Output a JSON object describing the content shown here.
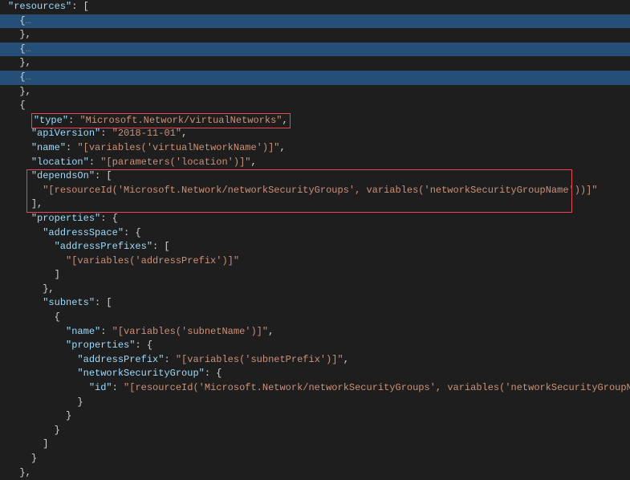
{
  "header": {
    "resources_key": "\"resources\"",
    "colon_bracket": ": ["
  },
  "collapsed": {
    "open": "{",
    "dots": "…",
    "close": "},"
  },
  "obj_open": "{",
  "type_line": {
    "key": "\"type\"",
    "sep": ": ",
    "val": "\"Microsoft.Network/virtualNetworks\"",
    "comma": ","
  },
  "apiVersion": {
    "key": "\"apiVersion\"",
    "sep": ": ",
    "val": "\"2018-11-01\"",
    "comma": ","
  },
  "name": {
    "key": "\"name\"",
    "sep": ": ",
    "val": "\"[variables('virtualNetworkName')]\"",
    "comma": ","
  },
  "location": {
    "key": "\"location\"",
    "sep": ": ",
    "val": "\"[parameters('location')]\"",
    "comma": ","
  },
  "dependsOn": {
    "key": "\"dependsOn\"",
    "sep": ": [",
    "item": "\"[resourceId('Microsoft.Network/networkSecurityGroups', variables('networkSecurityGroupName'))]\"",
    "close": "],"
  },
  "properties": {
    "key": "\"properties\"",
    "sep": ": {"
  },
  "addressSpace": {
    "key": "\"addressSpace\"",
    "sep": ": {",
    "prefixes_key": "\"addressPrefixes\"",
    "prefixes_sep": ": [",
    "prefix_item": "\"[variables('addressPrefix')]\"",
    "close_arr": "]",
    "close_obj": "},"
  },
  "subnets": {
    "key": "\"subnets\"",
    "sep": ": [",
    "open": "{",
    "name_key": "\"name\"",
    "name_sep": ": ",
    "name_val": "\"[variables('subnetName')]\"",
    "name_comma": ",",
    "props_key": "\"properties\"",
    "props_sep": ": {",
    "addrPrefix_key": "\"addressPrefix\"",
    "addrPrefix_sep": ": ",
    "addrPrefix_val": "\"[variables('subnetPrefix')]\"",
    "addrPrefix_comma": ",",
    "nsg_key": "\"networkSecurityGroup\"",
    "nsg_sep": ": {",
    "id_key": "\"id\"",
    "id_sep": ": ",
    "id_val": "\"[resourceId('Microsoft.Network/networkSecurityGroups', variables('networkSecurityGroupName'))]\"",
    "close_nsg": "}",
    "close_props": "}",
    "close_sub": "}",
    "close_arr": "]"
  },
  "close_props": "}",
  "close_obj": "},"
}
